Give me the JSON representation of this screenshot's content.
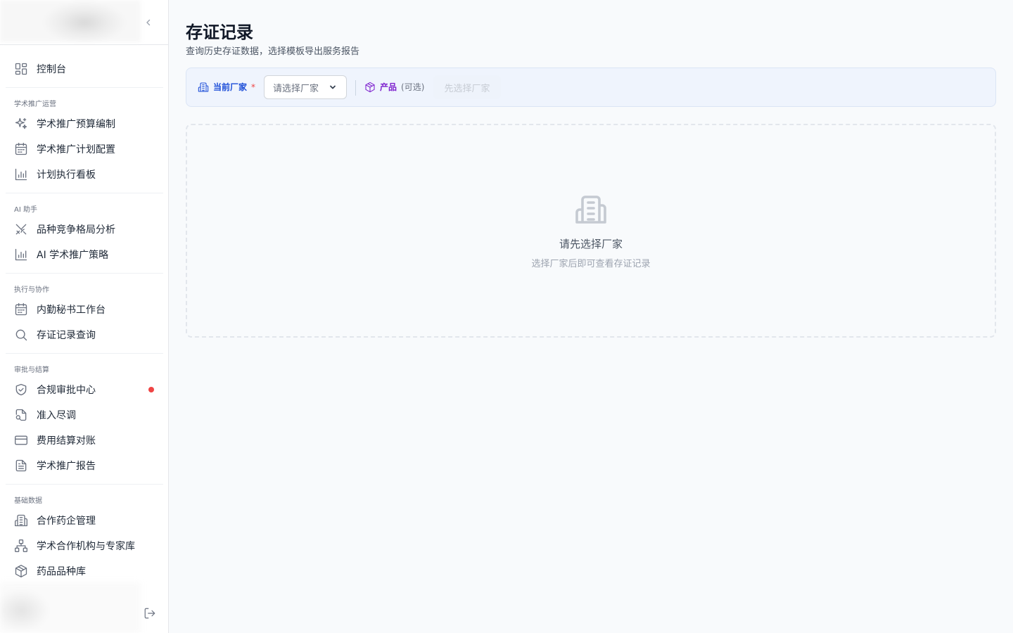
{
  "sidebar": {
    "dashboard_label": "控制台",
    "groups": [
      {
        "label": "学术推广运营",
        "items": [
          {
            "label": "学术推广预算编制",
            "icon": "sparkles-icon"
          },
          {
            "label": "学术推广计划配置",
            "icon": "calendar-icon"
          },
          {
            "label": "计划执行看板",
            "icon": "bar-chart-icon"
          }
        ]
      },
      {
        "label": "AI 助手",
        "items": [
          {
            "label": "品种竞争格局分析",
            "icon": "swords-icon"
          },
          {
            "label": "AI 学术推广策略",
            "icon": "bar-chart-icon"
          }
        ]
      },
      {
        "label": "执行与协作",
        "items": [
          {
            "label": "内勤秘书工作台",
            "icon": "calendar-icon"
          },
          {
            "label": "存证记录查询",
            "icon": "search-icon"
          }
        ]
      },
      {
        "label": "审批与结算",
        "items": [
          {
            "label": "合规审批中心",
            "icon": "shield-check-icon",
            "badge_color": "#ef4444"
          },
          {
            "label": "准入尽调",
            "icon": "file-search-icon"
          },
          {
            "label": "费用结算对账",
            "icon": "credit-card-icon"
          },
          {
            "label": "学术推广报告",
            "icon": "file-text-icon"
          }
        ]
      },
      {
        "label": "基础数据",
        "items": [
          {
            "label": "合作药企管理",
            "icon": "building-icon"
          },
          {
            "label": "学术合作机构与专家库",
            "icon": "network-icon"
          },
          {
            "label": "药品品种库",
            "icon": "package-icon"
          }
        ]
      }
    ]
  },
  "main": {
    "title": "存证记录",
    "subtitle": "查询历史存证数据，选择模板导出服务报告",
    "filter": {
      "vendor_label": "当前厂家",
      "vendor_required": "*",
      "vendor_placeholder": "请选择厂家",
      "product_label": "产品",
      "product_optional": "(可选)",
      "product_placeholder": "先选择厂家"
    },
    "empty": {
      "title": "请先选择厂家",
      "description": "选择厂家后即可查看存证记录"
    }
  },
  "colors": {
    "accent_blue": "#1d4ed8",
    "accent_purple": "#7e22ce",
    "required_red": "#ef4444",
    "background": "#f8fafc"
  }
}
